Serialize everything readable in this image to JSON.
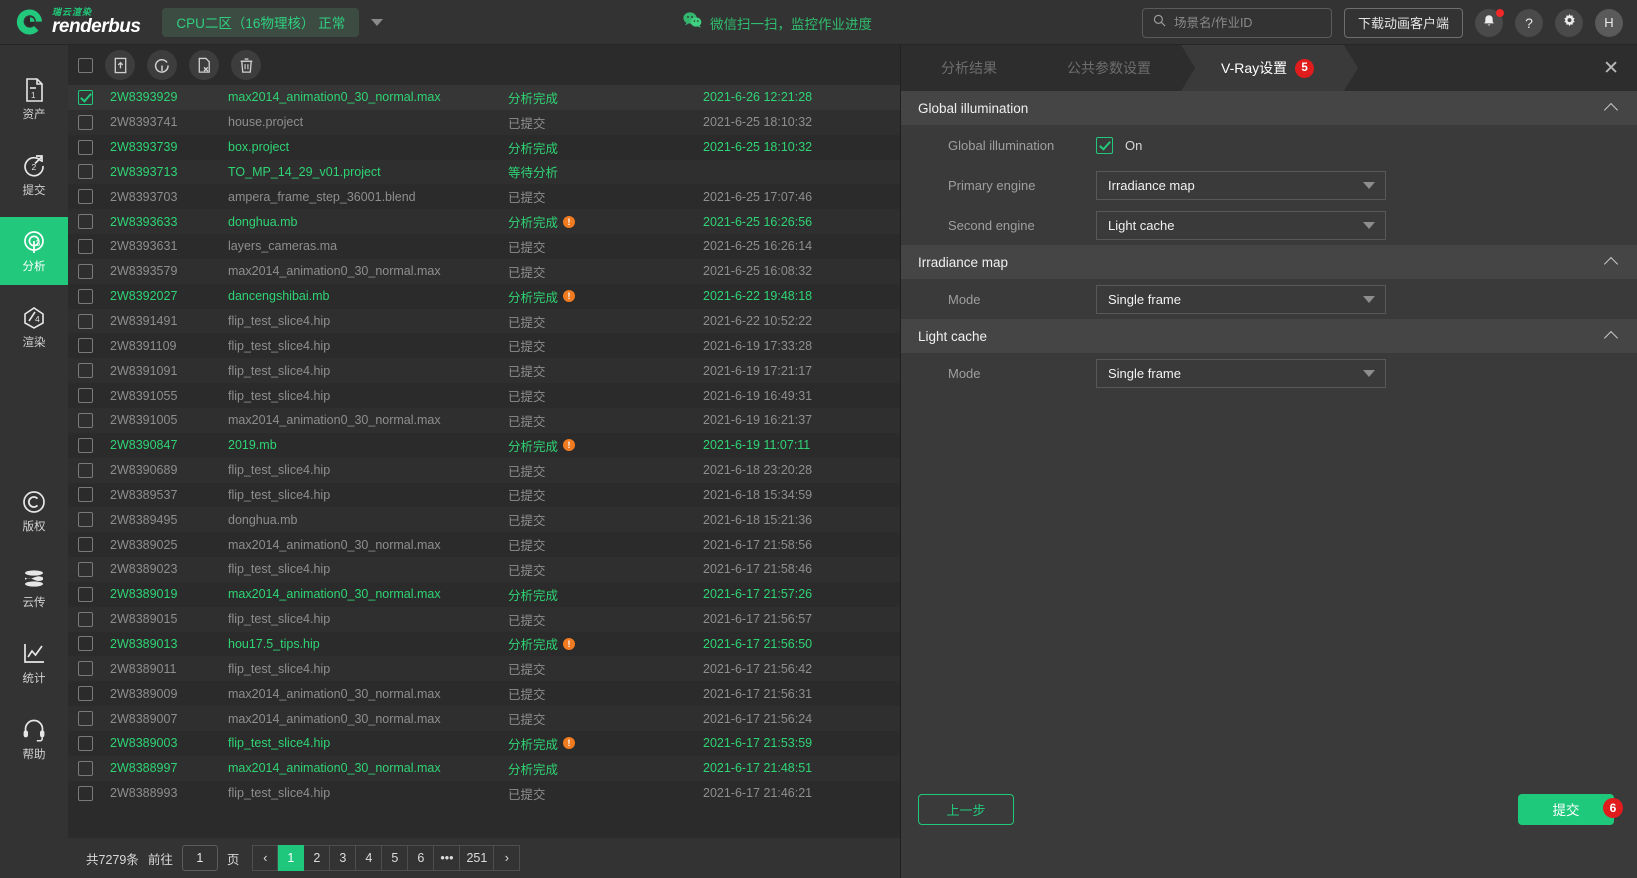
{
  "header": {
    "logo_cn": "瑞云渲染",
    "logo_en": "renderbus",
    "zone_chip": "CPU二区（16物理核）  正常",
    "wechat_text": "微信扫一扫，监控作业进度",
    "search_placeholder": "场景名/作业ID",
    "search_value": "",
    "download_btn": "下载动画客户端",
    "help_glyph": "?",
    "avatar_initial": "H",
    "accent": "#22c97c",
    "badge_red": "#e01c1c"
  },
  "sidebar": {
    "items": [
      {
        "label": "资产",
        "icon": "assets-icon",
        "num": "1",
        "active": false
      },
      {
        "label": "提交",
        "icon": "submit-icon",
        "num": "2",
        "active": false
      },
      {
        "label": "分析",
        "icon": "analyze-icon",
        "num": "3",
        "active": true
      },
      {
        "label": "渲染",
        "icon": "render-icon",
        "num": "4",
        "active": false
      },
      {
        "label": "版权",
        "icon": "copyright-icon",
        "num": "",
        "active": false
      },
      {
        "label": "云传",
        "icon": "cloud-transfer-icon",
        "num": "",
        "active": false
      },
      {
        "label": "统计",
        "icon": "statistics-icon",
        "num": "",
        "active": false
      },
      {
        "label": "帮助",
        "icon": "headset-help-icon",
        "num": "",
        "active": false
      }
    ]
  },
  "toolbar": {
    "select_all_checked": false,
    "buttons": [
      {
        "name": "submit-job-icon",
        "title": "提交"
      },
      {
        "name": "reanalyze-icon",
        "title": "重新分析"
      },
      {
        "name": "cancel-analysis-icon",
        "title": "取消分析"
      },
      {
        "name": "delete-icon",
        "title": "删除"
      }
    ]
  },
  "table": {
    "rows": [
      {
        "id": "2W8393929",
        "file": "max2014_animation0_30_normal.max",
        "status": "分析完成",
        "warn": false,
        "time": "2021-6-26 12:21:28",
        "time2": "20",
        "state": "green",
        "checked": true
      },
      {
        "id": "2W8393741",
        "file": "house.project",
        "status": "已提交",
        "warn": false,
        "time": "2021-6-25 18:10:32",
        "time2": "20",
        "state": "gray",
        "checked": false
      },
      {
        "id": "2W8393739",
        "file": "box.project",
        "status": "分析完成",
        "warn": false,
        "time": "2021-6-25 18:10:32",
        "time2": "20",
        "state": "green",
        "checked": false
      },
      {
        "id": "2W8393713",
        "file": "TO_MP_14_29_v01.project",
        "status": "等待分析",
        "warn": false,
        "time": "",
        "time2": "",
        "state": "green",
        "checked": false
      },
      {
        "id": "2W8393703",
        "file": "ampera_frame_step_36001.blend",
        "status": "已提交",
        "warn": false,
        "time": "2021-6-25 17:07:46",
        "time2": "20",
        "state": "gray",
        "checked": false
      },
      {
        "id": "2W8393633",
        "file": "donghua.mb",
        "status": "分析完成",
        "warn": true,
        "time": "2021-6-25 16:26:56",
        "time2": "20",
        "state": "green",
        "checked": false
      },
      {
        "id": "2W8393631",
        "file": "layers_cameras.ma",
        "status": "已提交",
        "warn": false,
        "time": "2021-6-25 16:26:14",
        "time2": "20",
        "state": "gray",
        "checked": false
      },
      {
        "id": "2W8393579",
        "file": "max2014_animation0_30_normal.max",
        "status": "已提交",
        "warn": false,
        "time": "2021-6-25 16:08:32",
        "time2": "20",
        "state": "gray",
        "checked": false
      },
      {
        "id": "2W8392027",
        "file": "dancengshibai.mb",
        "status": "分析完成",
        "warn": true,
        "time": "2021-6-22 19:48:18",
        "time2": "20",
        "state": "green",
        "checked": false
      },
      {
        "id": "2W8391491",
        "file": "flip_test_slice4.hip",
        "status": "已提交",
        "warn": false,
        "time": "2021-6-22 10:52:22",
        "time2": "20",
        "state": "gray",
        "checked": false
      },
      {
        "id": "2W8391109",
        "file": "flip_test_slice4.hip",
        "status": "已提交",
        "warn": false,
        "time": "2021-6-19 17:33:28",
        "time2": "20",
        "state": "gray",
        "checked": false
      },
      {
        "id": "2W8391091",
        "file": "flip_test_slice4.hip",
        "status": "已提交",
        "warn": false,
        "time": "2021-6-19 17:21:17",
        "time2": "20",
        "state": "gray",
        "checked": false
      },
      {
        "id": "2W8391055",
        "file": "flip_test_slice4.hip",
        "status": "已提交",
        "warn": false,
        "time": "2021-6-19 16:49:31",
        "time2": "20",
        "state": "gray",
        "checked": false
      },
      {
        "id": "2W8391005",
        "file": "max2014_animation0_30_normal.max",
        "status": "已提交",
        "warn": false,
        "time": "2021-6-19 16:21:37",
        "time2": "20",
        "state": "gray",
        "checked": false
      },
      {
        "id": "2W8390847",
        "file": "2019.mb",
        "status": "分析完成",
        "warn": true,
        "time": "2021-6-19 11:07:11",
        "time2": "20",
        "state": "green",
        "checked": false
      },
      {
        "id": "2W8390689",
        "file": "flip_test_slice4.hip",
        "status": "已提交",
        "warn": false,
        "time": "2021-6-18 23:20:28",
        "time2": "20",
        "state": "gray",
        "checked": false
      },
      {
        "id": "2W8389537",
        "file": "flip_test_slice4.hip",
        "status": "已提交",
        "warn": false,
        "time": "2021-6-18 15:34:59",
        "time2": "20",
        "state": "gray",
        "checked": false
      },
      {
        "id": "2W8389495",
        "file": "donghua.mb",
        "status": "已提交",
        "warn": false,
        "time": "2021-6-18 15:21:36",
        "time2": "20",
        "state": "gray",
        "checked": false
      },
      {
        "id": "2W8389025",
        "file": "max2014_animation0_30_normal.max",
        "status": "已提交",
        "warn": false,
        "time": "2021-6-17 21:58:56",
        "time2": "20",
        "state": "gray",
        "checked": false
      },
      {
        "id": "2W8389023",
        "file": "flip_test_slice4.hip",
        "status": "已提交",
        "warn": false,
        "time": "2021-6-17 21:58:46",
        "time2": "20",
        "state": "gray",
        "checked": false
      },
      {
        "id": "2W8389019",
        "file": "max2014_animation0_30_normal.max",
        "status": "分析完成",
        "warn": false,
        "time": "2021-6-17 21:57:26",
        "time2": "20",
        "state": "green",
        "checked": false
      },
      {
        "id": "2W8389015",
        "file": "flip_test_slice4.hip",
        "status": "已提交",
        "warn": false,
        "time": "2021-6-17 21:56:57",
        "time2": "20",
        "state": "gray",
        "checked": false
      },
      {
        "id": "2W8389013",
        "file": "hou17.5_tips.hip",
        "status": "分析完成",
        "warn": true,
        "time": "2021-6-17 21:56:50",
        "time2": "20",
        "state": "green",
        "checked": false
      },
      {
        "id": "2W8389011",
        "file": "flip_test_slice4.hip",
        "status": "已提交",
        "warn": false,
        "time": "2021-6-17 21:56:42",
        "time2": "20",
        "state": "gray",
        "checked": false
      },
      {
        "id": "2W8389009",
        "file": "max2014_animation0_30_normal.max",
        "status": "已提交",
        "warn": false,
        "time": "2021-6-17 21:56:31",
        "time2": "20",
        "state": "gray",
        "checked": false
      },
      {
        "id": "2W8389007",
        "file": "max2014_animation0_30_normal.max",
        "status": "已提交",
        "warn": false,
        "time": "2021-6-17 21:56:24",
        "time2": "20",
        "state": "gray",
        "checked": false
      },
      {
        "id": "2W8389003",
        "file": "flip_test_slice4.hip",
        "status": "分析完成",
        "warn": true,
        "time": "2021-6-17 21:53:59",
        "time2": "20",
        "state": "green",
        "checked": false
      },
      {
        "id": "2W8388997",
        "file": "max2014_animation0_30_normal.max",
        "status": "分析完成",
        "warn": false,
        "time": "2021-6-17 21:48:51",
        "time2": "20",
        "state": "green",
        "checked": false
      },
      {
        "id": "2W8388993",
        "file": "flip_test_slice4.hip",
        "status": "已提交",
        "warn": false,
        "time": "2021-6-17 21:46:21",
        "time2": "20",
        "state": "gray",
        "checked": false
      }
    ]
  },
  "footer": {
    "total_text": "共7279条",
    "goto_label": "前往",
    "goto_value": "1",
    "page_unit": "页",
    "prev_glyph": "‹",
    "next_glyph": "›",
    "pages": [
      "1",
      "2",
      "3",
      "4",
      "5",
      "6",
      "•••",
      "251"
    ],
    "active_page": "1"
  },
  "panel": {
    "tabs": [
      {
        "label": "分析结果",
        "active": false,
        "badge": ""
      },
      {
        "label": "公共参数设置",
        "active": false,
        "badge": ""
      },
      {
        "label": "V-Ray设置",
        "active": true,
        "badge": "5"
      }
    ],
    "close_glyph": "✕",
    "sections": [
      {
        "title": "Global illumination",
        "fields": [
          {
            "type": "checkbox",
            "label": "Global illumination",
            "value": "On",
            "checked": true
          },
          {
            "type": "select",
            "label": "Primary engine",
            "value": "Irradiance map"
          },
          {
            "type": "select",
            "label": "Second engine",
            "value": "Light cache"
          }
        ]
      },
      {
        "title": "Irradiance map",
        "fields": [
          {
            "type": "select",
            "label": "Mode",
            "value": "Single frame"
          }
        ]
      },
      {
        "title": "Light cache",
        "fields": [
          {
            "type": "select",
            "label": "Mode",
            "value": "Single frame"
          }
        ]
      }
    ],
    "prev_btn": "上一步",
    "submit_btn": "提交",
    "submit_badge": "6"
  }
}
